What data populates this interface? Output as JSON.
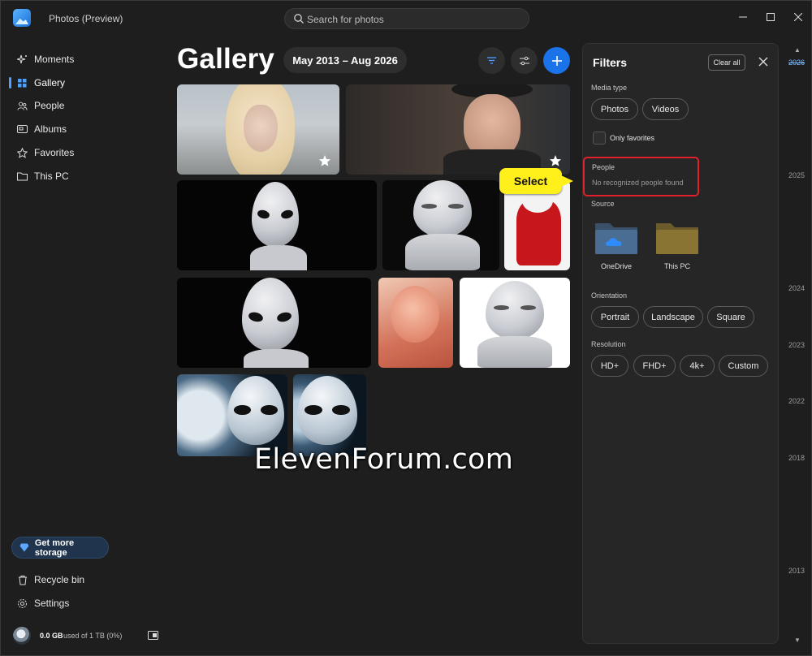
{
  "titlebar": {
    "app_title": "Photos (Preview)",
    "search_placeholder": "Search for photos"
  },
  "sidebar": {
    "items": [
      {
        "label": "Moments",
        "icon": "sparkle-icon"
      },
      {
        "label": "Gallery",
        "icon": "grid-icon",
        "active": true
      },
      {
        "label": "People",
        "icon": "people-icon"
      },
      {
        "label": "Albums",
        "icon": "album-icon"
      },
      {
        "label": "Favorites",
        "icon": "star-icon"
      },
      {
        "label": "This PC",
        "icon": "folder-icon"
      }
    ],
    "storage_button": "Get more storage",
    "recycle_bin": "Recycle bin",
    "settings": "Settings",
    "storage_used": "0.0 GB",
    "storage_detail": "used of 1 TB (0%)"
  },
  "main": {
    "title": "Gallery",
    "date_range": "May 2013 – Aug 2026"
  },
  "filters": {
    "title": "Filters",
    "clear_all": "Clear all",
    "media_type_heading": "Media type",
    "media_types": [
      "Photos",
      "Videos"
    ],
    "only_favorites": "Only favorites",
    "people_heading": "People",
    "people_empty": "No recognized people found",
    "source_heading": "Source",
    "sources": [
      "OneDrive",
      "This PC"
    ],
    "orientation_heading": "Orientation",
    "orientations": [
      "Portrait",
      "Landscape",
      "Square"
    ],
    "resolution_heading": "Resolution",
    "resolutions": [
      "HD+",
      "FHD+",
      "4k+",
      "Custom"
    ]
  },
  "callout": "Select",
  "watermark": "ElevenForum.com",
  "timeline": [
    "2026",
    "2025",
    "2024",
    "2023",
    "2022",
    "2018",
    "2013"
  ],
  "colors": {
    "accent": "#1a73e8",
    "highlight": "#e0202a",
    "callout": "#ffef1a"
  }
}
